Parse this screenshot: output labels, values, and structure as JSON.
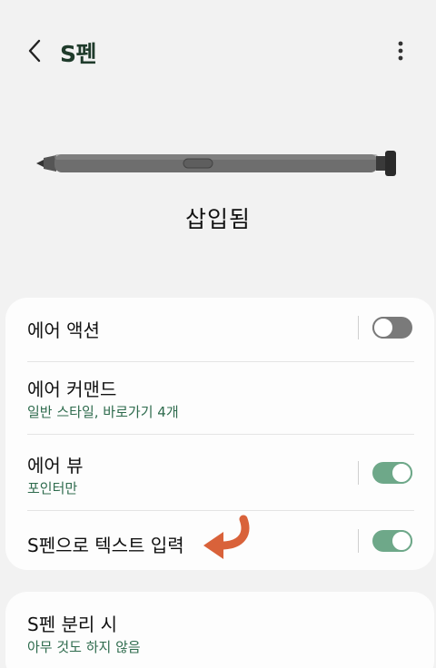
{
  "header": {
    "title": "S펜",
    "back_icon": "chevron-left-icon",
    "more_icon": "more-vert-icon"
  },
  "pen": {
    "status": "삽입됨"
  },
  "settings": {
    "air_action": {
      "label": "에어 액션",
      "enabled": false
    },
    "air_command": {
      "label": "에어 커맨드",
      "summary": "일반 스타일, 바로가기 4개"
    },
    "air_view": {
      "label": "에어 뷰",
      "summary": "포인터만",
      "enabled": true
    },
    "pen_to_text": {
      "label": "S펜으로 텍스트 입력",
      "enabled": true
    },
    "pen_detach": {
      "label": "S펜 분리 시",
      "summary": "아무 것도 하지 않음"
    }
  },
  "colors": {
    "accent": "#2e6b4d",
    "toggle_on": "#6ea889",
    "toggle_off": "#7a7a7a",
    "annotation_arrow": "#d9623a"
  }
}
